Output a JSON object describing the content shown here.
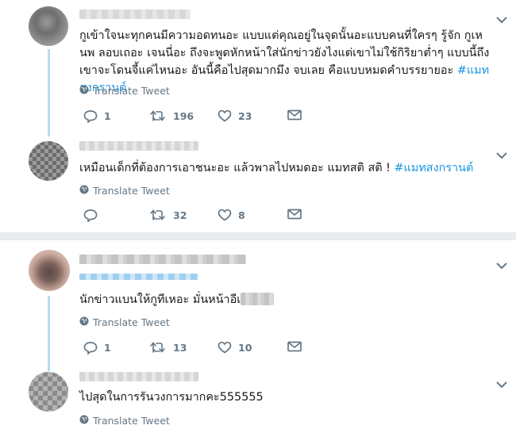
{
  "tweets": [
    {
      "text": "กูเข้าใจนะทุกคนมีความอดทนอะ แบบแต่คุณอยู่ในจุดนั้นอะแบบคนที่ใครๆ รู้จัก กูเหนพ ลอบเถอะ เจนนี่อะ ถึงจะพูดหักหน้าใส่นักข่าวยังไงแต่เขาไม่ใช้กิริยาต่ำๆ แบบนี้ถึงเขาจะโดนจี้แค่ไหนอะ อันนี้คือไปสุดมากมึง จบเลย คือแบบหมดคำบรรยายอะ ",
      "hashtag": "#แมทสงกรานต์",
      "translate": "Translate Tweet",
      "replies": "1",
      "retweets": "196",
      "likes": "23"
    },
    {
      "text": "เหมือนเด็กที่ต้องการเอาชนะอะ แล้วพาลไปหมดอะ แมทสติ สติ ! ",
      "hashtag": "#แมทสงกรานต์",
      "translate": "Translate Tweet",
      "replies": "",
      "retweets": "32",
      "likes": "8"
    },
    {
      "text": "นักข่าวแบนให้กูทีเหอะ มั่นหน้าอีเ",
      "translate": "Translate Tweet",
      "replies": "1",
      "retweets": "13",
      "likes": "10"
    },
    {
      "text": "ไปสุดในการรันวงการมากคะ555555",
      "translate": "Translate Tweet"
    }
  ],
  "colors": {
    "link": "#1b95e0",
    "muted": "#657786",
    "thread": "#b6dcf3",
    "separator": "#e6ecf0"
  },
  "icons": [
    "chevron-down-icon",
    "globe-icon",
    "reply-icon",
    "retweet-icon",
    "like-icon",
    "message-icon"
  ]
}
